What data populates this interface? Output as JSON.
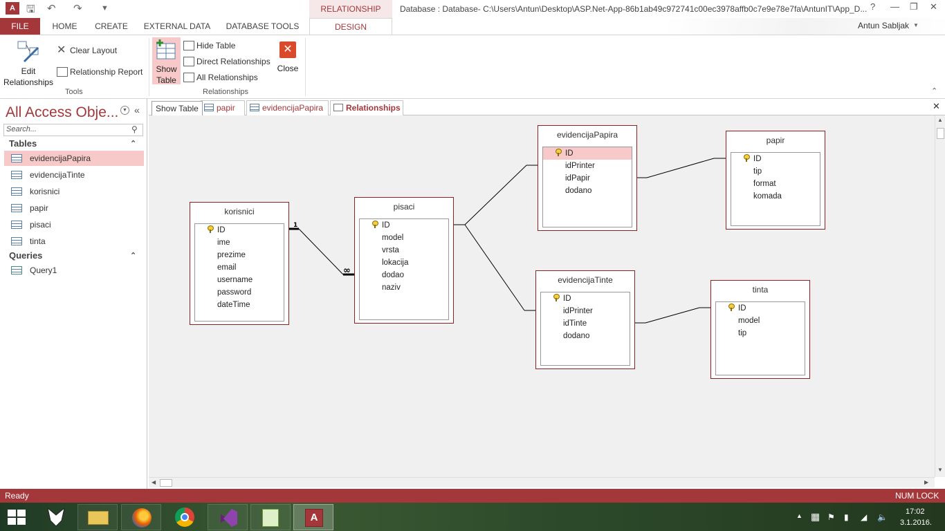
{
  "window": {
    "title": "Database : Database- C:\\Users\\Antun\\Desktop\\ASP.Net-App-86b1ab49c972741c00ec3978affb0c7e9e78e7fa\\AntunIT\\App_D...",
    "context_tab": "RELATIONSHIP TOOLS",
    "user": "Antun Sabljak",
    "help": "?"
  },
  "ribbon_tabs": [
    "FILE",
    "HOME",
    "CREATE",
    "EXTERNAL DATA",
    "DATABASE TOOLS",
    "DESIGN"
  ],
  "ribbon": {
    "edit_relationships": "Edit\nRelationships",
    "clear_layout": "Clear Layout",
    "relationship_report": "Relationship Report",
    "tools_group": "Tools",
    "show_table": "Show\nTable",
    "hide_table": "Hide Table",
    "direct_relationships": "Direct Relationships",
    "all_relationships": "All Relationships",
    "close": "Close",
    "relationships_group": "Relationships"
  },
  "nav": {
    "title": "All Access Obje...",
    "search_placeholder": "Search...",
    "sections": [
      {
        "label": "Tables",
        "items": [
          "evidencijaPapira",
          "evidencijaTinte",
          "korisnici",
          "papir",
          "pisaci",
          "tinta"
        ],
        "selected": "evidencijaPapira"
      },
      {
        "label": "Queries",
        "items": [
          "Query1"
        ]
      }
    ]
  },
  "doc_tabs": {
    "tooltip": "Show Table",
    "tabs": [
      "papir",
      "evidencijaPapira",
      "Relationships"
    ],
    "active": "Relationships"
  },
  "relationship_tables": [
    {
      "name": "korisnici",
      "fields": [
        "ID",
        "ime",
        "prezime",
        "email",
        "username",
        "password",
        "dateTime"
      ],
      "key": "ID"
    },
    {
      "name": "pisaci",
      "fields": [
        "ID",
        "model",
        "vrsta",
        "lokacija",
        "dodao",
        "naziv"
      ],
      "key": "ID"
    },
    {
      "name": "evidencijaPapira",
      "fields": [
        "ID",
        "idPrinter",
        "idPapir",
        "dodano"
      ],
      "key": "ID",
      "selected_field": "ID"
    },
    {
      "name": "papir",
      "fields": [
        "ID",
        "tip",
        "format",
        "komada"
      ],
      "key": "ID"
    },
    {
      "name": "evidencijaTinte",
      "fields": [
        "ID",
        "idPrinter",
        "idTinte",
        "dodano"
      ],
      "key": "ID"
    },
    {
      "name": "tinta",
      "fields": [
        "ID",
        "model",
        "tip"
      ],
      "key": "ID"
    }
  ],
  "relationships": [
    {
      "from": "korisnici",
      "to": "pisaci",
      "one": "1",
      "many": "∞"
    },
    {
      "from": "pisaci",
      "to": "evidencijaPapira"
    },
    {
      "from": "pisaci",
      "to": "evidencijaTinte"
    },
    {
      "from": "evidencijaPapira",
      "to": "papir"
    },
    {
      "from": "evidencijaTinte",
      "to": "tinta"
    }
  ],
  "status": {
    "left": "Ready",
    "right": "NUM LOCK"
  },
  "taskbar": {
    "time": "17:02",
    "date": "3.1.2016."
  },
  "colors": {
    "accent": "#a4373a",
    "relationship_line": "#000000",
    "selection": "#f7c9c9"
  }
}
